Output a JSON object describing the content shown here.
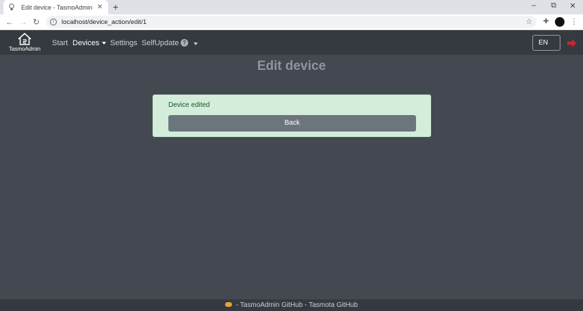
{
  "browser": {
    "tab_title": "Edit device - TasmoAdmin",
    "tab_close": "✕",
    "new_tab": "+",
    "url": "localhost/device_action/edit/1",
    "window_controls": {
      "minimize": "–",
      "restore": "⧉",
      "close": "✕"
    }
  },
  "navbar": {
    "brand": "TasmoAdmin",
    "links": {
      "start": "Start",
      "devices": "Devices",
      "settings": "Settings",
      "selfupdate": "SelfUpdate"
    },
    "help_icon": "?",
    "language": "EN"
  },
  "page": {
    "title": "Edit device",
    "alert_message": "Device edited",
    "back_label": "Back"
  },
  "footer": {
    "tasmoadmin_link": "TasmoAdmin GitHub",
    "separator": " - ",
    "tasmota_link": "Tasmota GitHub"
  },
  "colors": {
    "navbar_bg": "#343a40",
    "page_bg": "#444851",
    "alert_bg": "#d4edda",
    "alert_text": "#155724",
    "back_button_bg": "#6c757d",
    "logout_icon": "#dc3545"
  },
  "icons": {
    "favicon": "bulb-icon",
    "brand": "house-icon",
    "help": "question-circle-icon",
    "logout": "sign-out-icon",
    "footer": "cloud-icon"
  }
}
